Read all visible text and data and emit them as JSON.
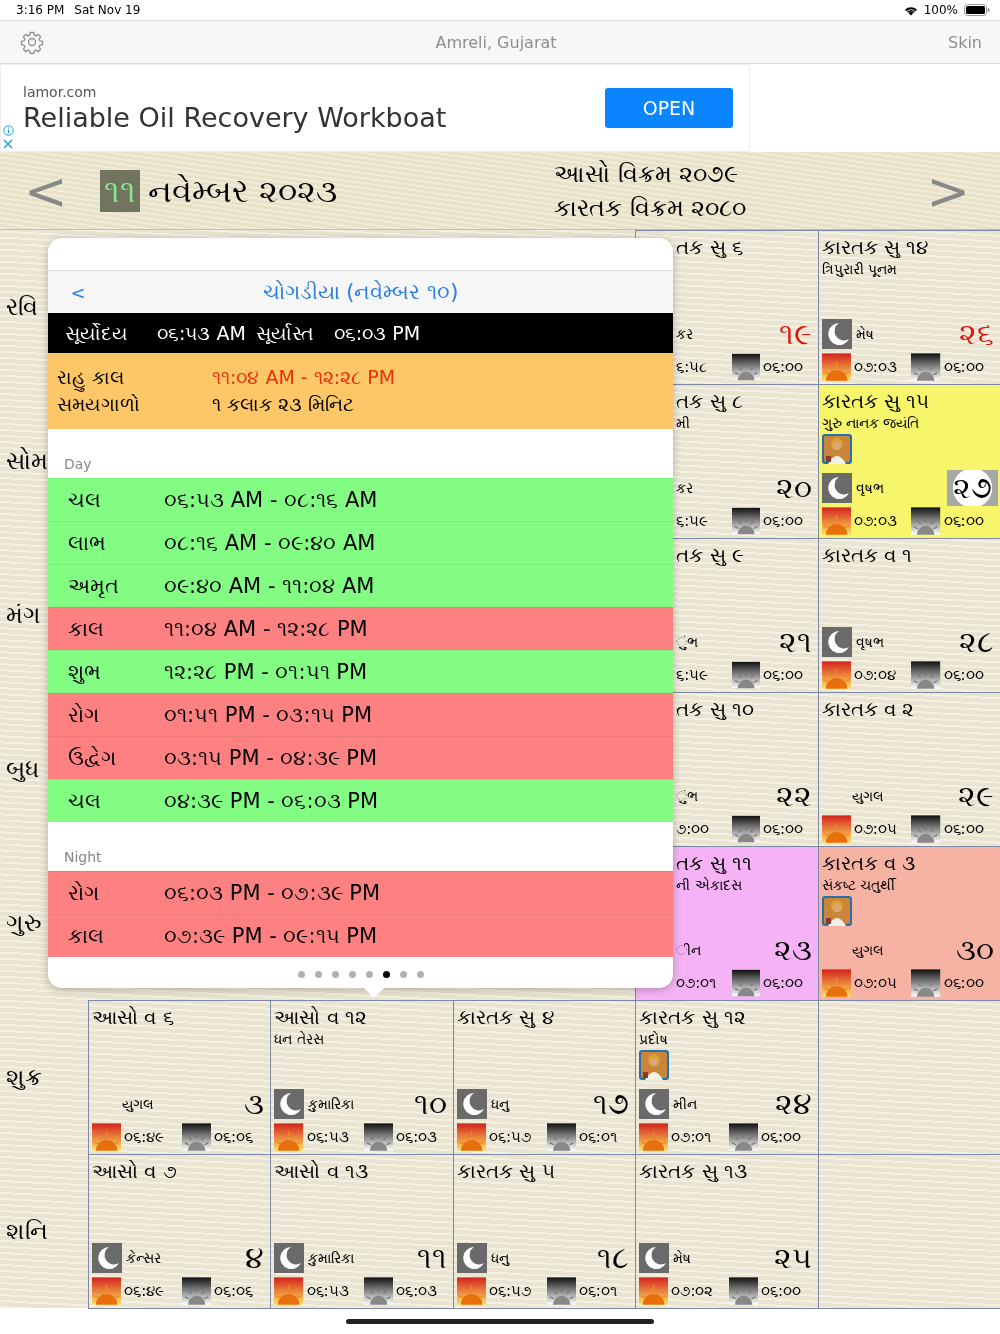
{
  "status_bar": {
    "time": "3:16 PM",
    "date": "Sat Nov 19",
    "battery": "100%"
  },
  "nav": {
    "title": "Amreli, Gujarat",
    "right": "Skin"
  },
  "ad": {
    "domain": "lamor.com",
    "headline": "Reliable Oil Recovery Workboat",
    "button": "OPEN"
  },
  "month_header": {
    "prev": "<",
    "day": "૧૧",
    "month": "નવેમ્બર ૨૦૨૩",
    "era_lines": [
      "આસો વિક્રમ ૨૦૭૯",
      "કારતક વિક્રમ ૨૦૮૦"
    ],
    "next": ">"
  },
  "calendar": {
    "rows": [
      {
        "weekday": "રવિ",
        "holiday": true,
        "cells": [
          {
            "kind": "covered"
          },
          {
            "kind": "covered"
          },
          {
            "kind": "covered"
          },
          {
            "kind": "partial",
            "tithi": "તક સુ ૬",
            "moon": false,
            "rashi": "કર",
            "date": "૧૯",
            "today": false,
            "sunrise": "૬:૫૮",
            "sunset": "૦૬:૦૦"
          },
          {
            "kind": "day",
            "tithi": "કારતક સુ ૧૪",
            "note": "ત્રિપુરારી પૂનમ",
            "moon": true,
            "rashi": "મેષ",
            "date": "૨૬",
            "today": false,
            "sunrise": "૦૭:૦૩",
            "sunset": "૦૬:૦૦"
          }
        ]
      },
      {
        "weekday": "સોમ",
        "holiday": false,
        "cells": [
          {
            "kind": "covered"
          },
          {
            "kind": "covered"
          },
          {
            "kind": "covered"
          },
          {
            "kind": "partial",
            "tithi": "તક સુ ૮",
            "note": "મી",
            "moon": false,
            "rashi": "કર",
            "date": "૨૦",
            "today": false,
            "sunrise": "૬:૫૯",
            "sunset": "૦૬:૦૦"
          },
          {
            "kind": "day",
            "color": "#f7f56c",
            "tithi": "કારતક સુ ૧૫",
            "note": "ગુરુ નાનક જયંતિ",
            "image": true,
            "moon": true,
            "rashi": "વૃષભ",
            "date": "૨૭",
            "today": true,
            "sunrise": "૦૭:૦૩",
            "sunset": "૦૬:૦૦"
          }
        ]
      },
      {
        "weekday": "મંગ",
        "holiday": false,
        "cells": [
          {
            "kind": "covered"
          },
          {
            "kind": "covered"
          },
          {
            "kind": "covered"
          },
          {
            "kind": "partial",
            "tithi": "તક સુ ૯",
            "moon": false,
            "rashi": "ુંભ",
            "date": "૨૧",
            "today": false,
            "sunrise": "૬:૫૯",
            "sunset": "૦૬:૦૦"
          },
          {
            "kind": "day",
            "tithi": "કારતક વ ૧",
            "moon": true,
            "rashi": "વૃષભ",
            "date": "૨૮",
            "today": false,
            "sunrise": "૦૭:૦૪",
            "sunset": "૦૬:૦૦"
          }
        ]
      },
      {
        "weekday": "બુધ",
        "holiday": false,
        "cells": [
          {
            "kind": "covered"
          },
          {
            "kind": "covered"
          },
          {
            "kind": "covered"
          },
          {
            "kind": "partial",
            "tithi": "તક સુ ૧૦",
            "moon": false,
            "rashi": "ુંભ",
            "date": "૨૨",
            "today": false,
            "sunrise": "૭:૦૦",
            "sunset": "૦૬:૦૦"
          },
          {
            "kind": "day",
            "tithi": "કારતક વ ૨",
            "moon": false,
            "rashi": "યુગલ",
            "date": "૨૯",
            "today": false,
            "sunrise": "૦૭:૦૫",
            "sunset": "૦૬:૦૦"
          }
        ]
      },
      {
        "weekday": "ગુરુ",
        "holiday": false,
        "cells": [
          {
            "kind": "covered"
          },
          {
            "kind": "covered"
          },
          {
            "kind": "covered"
          },
          {
            "kind": "partial",
            "color": "#f5b3f5",
            "tithi": "તક સુ ૧૧",
            "note": "ની એકાદસ",
            "moon": false,
            "rashi": "ીન",
            "date": "૨૩",
            "today": false,
            "sunrise": "૦૭:૦૧",
            "sunset": "૦૬:૦૦"
          },
          {
            "kind": "day",
            "color": "#f6b3a3",
            "tithi": "કારતક વ ૩",
            "note": "સંકષ્ટ ચતુર્થી",
            "image": true,
            "moon": false,
            "rashi": "યુગલ",
            "date": "૩૦",
            "today": false,
            "sunrise": "૦૭:૦૫",
            "sunset": "૦૬:૦૦"
          }
        ]
      },
      {
        "weekday": "શુક્ર",
        "holiday": false,
        "cells": [
          {
            "kind": "day",
            "tithi": "આસો વ ૬",
            "moon": false,
            "rashi": "યુગલ",
            "date": "૩",
            "today": false,
            "sunrise": "૦૬:૪૯",
            "sunset": "૦૬:૦૬"
          },
          {
            "kind": "day",
            "tithi": "આસો વ ૧૨",
            "note": "ધન તેરસ",
            "moon": true,
            "rashi": "કુમારિકા",
            "date": "૧૦",
            "today": false,
            "sunrise": "૦૬:૫૩",
            "sunset": "૦૬:૦૩"
          },
          {
            "kind": "day",
            "tithi": "કારતક સુ ૪",
            "moon": true,
            "rashi": "ધનુ",
            "date": "૧૭",
            "today": false,
            "sunrise": "૦૬:૫૭",
            "sunset": "૦૬:૦૧"
          },
          {
            "kind": "day",
            "tithi": "કારતક સુ ૧૨",
            "note": "પ્રદોષ",
            "image": true,
            "moon": true,
            "rashi": "મીન",
            "date": "૨૪",
            "today": false,
            "sunrise": "૦૭:૦૧",
            "sunset": "૦૬:૦૦"
          },
          {
            "kind": "blank"
          }
        ]
      },
      {
        "weekday": "શનિ",
        "holiday": false,
        "cells": [
          {
            "kind": "day",
            "tithi": "આસો વ ૭",
            "moon": true,
            "rashi": "કેન્સર",
            "date": "૪",
            "today": false,
            "sunrise": "૦૬:૪૯",
            "sunset": "૦૬:૦૬"
          },
          {
            "kind": "day",
            "tithi": "આસો વ ૧૩",
            "moon": true,
            "rashi": "કુમારિકા",
            "date": "૧૧",
            "today": false,
            "sunrise": "૦૬:૫૩",
            "sunset": "૦૬:૦૩"
          },
          {
            "kind": "day",
            "tithi": "કારતક સુ ૫",
            "moon": true,
            "rashi": "ધનુ",
            "date": "૧૮",
            "today": false,
            "sunrise": "૦૬:૫૭",
            "sunset": "૦૬:૦૧"
          },
          {
            "kind": "day",
            "tithi": "કારતક સુ ૧૩",
            "moon": true,
            "rashi": "મેષ",
            "date": "૨૫",
            "today": false,
            "sunrise": "૦૭:૦૨",
            "sunset": "૦૬:૦૦"
          },
          {
            "kind": "blank"
          }
        ]
      }
    ]
  },
  "popup": {
    "back": "<",
    "title": "ચોગડીયા (નવેમ્બર ૧૦)",
    "sun": {
      "rise_label": "સૂર્યોદય",
      "rise": "૦૬:૫૩ AM",
      "set_label": "સૂર્યાસ્ત",
      "set": "૦૬:૦૩ PM"
    },
    "rahu": {
      "label": "રાહુ કાલ",
      "time": "૧૧:૦૪ AM - ૧૨:૨૮ PM",
      "duration_label": "સમયગાળો",
      "duration": "૧ કલાક ૨૩ મિનિટ"
    },
    "sections": [
      {
        "title": "Day",
        "slots": [
          {
            "name": "ચલ",
            "time": "૦૬:૫૩ AM - ૦૮:૧૬ AM",
            "kind": "good"
          },
          {
            "name": "લાભ",
            "time": "૦૮:૧૬ AM - ૦૯:૪૦ AM",
            "kind": "good"
          },
          {
            "name": "અમૃત",
            "time": "૦૯:૪૦ AM - ૧૧:૦૪ AM",
            "kind": "good"
          },
          {
            "name": "કાલ",
            "time": "૧૧:૦૪ AM - ૧૨:૨૮ PM",
            "kind": "bad"
          },
          {
            "name": "શુભ",
            "time": "૧૨:૨૮ PM - ૦૧:૫૧ PM",
            "kind": "good"
          },
          {
            "name": "રોગ",
            "time": "૦૧:૫૧ PM - ૦૩:૧૫ PM",
            "kind": "bad"
          },
          {
            "name": "ઉદ્વેગ",
            "time": "૦૩:૧૫ PM - ૦૪:૩૯ PM",
            "kind": "bad"
          },
          {
            "name": "ચલ",
            "time": "૦૪:૩૯ PM - ૦૬:૦૩ PM",
            "kind": "good"
          }
        ]
      },
      {
        "title": "Night",
        "slots": [
          {
            "name": "રોગ",
            "time": "૦૬:૦૩ PM - ૦૭:૩૯ PM",
            "kind": "bad"
          },
          {
            "name": "કાલ",
            "time": "૦૭:૩૯ PM - ૦૯:૧૫ PM",
            "kind": "bad"
          }
        ]
      }
    ],
    "pages": [
      {
        "selected": false
      },
      {
        "selected": false
      },
      {
        "selected": false
      },
      {
        "selected": false
      },
      {
        "selected": false
      },
      {
        "selected": true
      },
      {
        "selected": false
      },
      {
        "selected": false
      }
    ]
  }
}
